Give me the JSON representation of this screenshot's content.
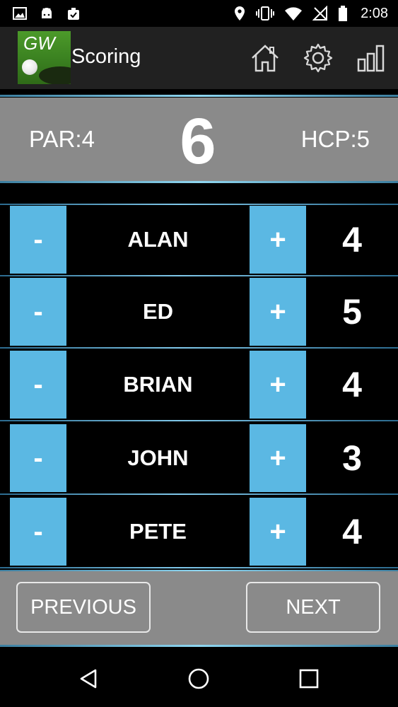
{
  "status_bar": {
    "time": "2:08",
    "icons_left": [
      "image-icon",
      "android-icon",
      "clipboard-check-icon"
    ],
    "icons_right": [
      "location-icon",
      "vibrate-icon",
      "wifi-icon",
      "no-signal-icon",
      "battery-icon"
    ]
  },
  "app_bar": {
    "logo_text": "GW",
    "title": "Scoring",
    "actions": [
      "home-icon",
      "settings-icon",
      "stats-icon"
    ]
  },
  "hole_info": {
    "par": "PAR:4",
    "hole_number": "6",
    "hcp": "HCP:5"
  },
  "players": [
    {
      "name": "ALAN",
      "score": "4",
      "minus_label": "-",
      "plus_label": "+"
    },
    {
      "name": "ED",
      "score": "5",
      "minus_label": "-",
      "plus_label": "+"
    },
    {
      "name": "BRIAN",
      "score": "4",
      "minus_label": "-",
      "plus_label": "+"
    },
    {
      "name": "JOHN",
      "score": "3",
      "minus_label": "-",
      "plus_label": "+"
    },
    {
      "name": "PETE",
      "score": "4",
      "minus_label": "-",
      "plus_label": "+"
    }
  ],
  "footer": {
    "previous_label": "PREVIOUS",
    "next_label": "NEXT"
  },
  "nav_bar": [
    "back-icon",
    "home-circle-icon",
    "recents-icon"
  ],
  "colors": {
    "accent_button": "#5bb8e3",
    "header_bg": "#8a8a8a",
    "app_bar_bg": "#212121"
  }
}
